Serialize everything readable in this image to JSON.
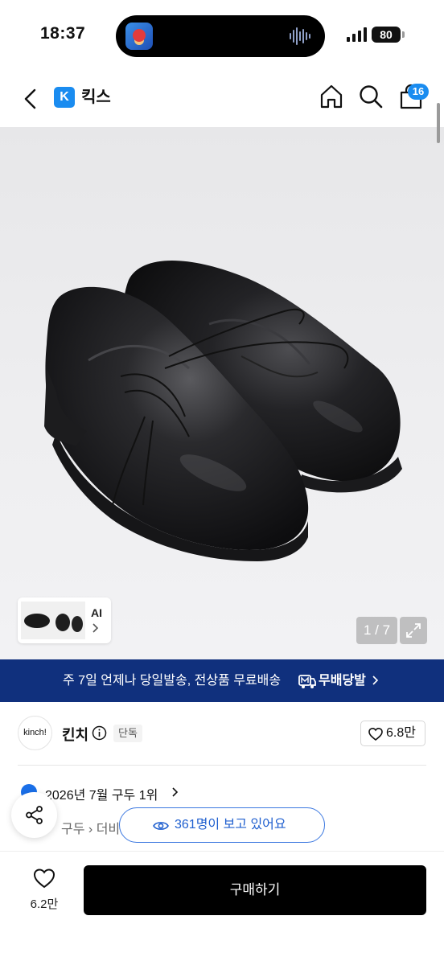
{
  "status_bar": {
    "time": "18:37",
    "battery": "80"
  },
  "header": {
    "brand_logo_letter": "K",
    "brand_name": "킥스",
    "cart_badge": "16"
  },
  "product_image": {
    "thumbnail_label": "AI",
    "page_indicator": "1 / 7"
  },
  "shipping_banner": {
    "text": "주 7일 언제나 당일발송, 전상품 무료배송",
    "brand": "무배당발"
  },
  "seller": {
    "logo_text": "kinch!",
    "name": "킨치",
    "badge": "단독",
    "likes": "6.8만"
  },
  "ranking": {
    "text": "2026년 7월 구두 1위"
  },
  "breadcrumb": {
    "items": [
      "구두",
      "더비"
    ]
  },
  "viewers": {
    "text": "361명이 보고 있어요"
  },
  "bottom_bar": {
    "wish_count": "6.2만",
    "buy_label": "구매하기"
  },
  "colors": {
    "accent": "#1a8cf0",
    "banner_bg": "#10307d",
    "buy_button": "#000000",
    "viewers_text": "#1f5fcf"
  }
}
